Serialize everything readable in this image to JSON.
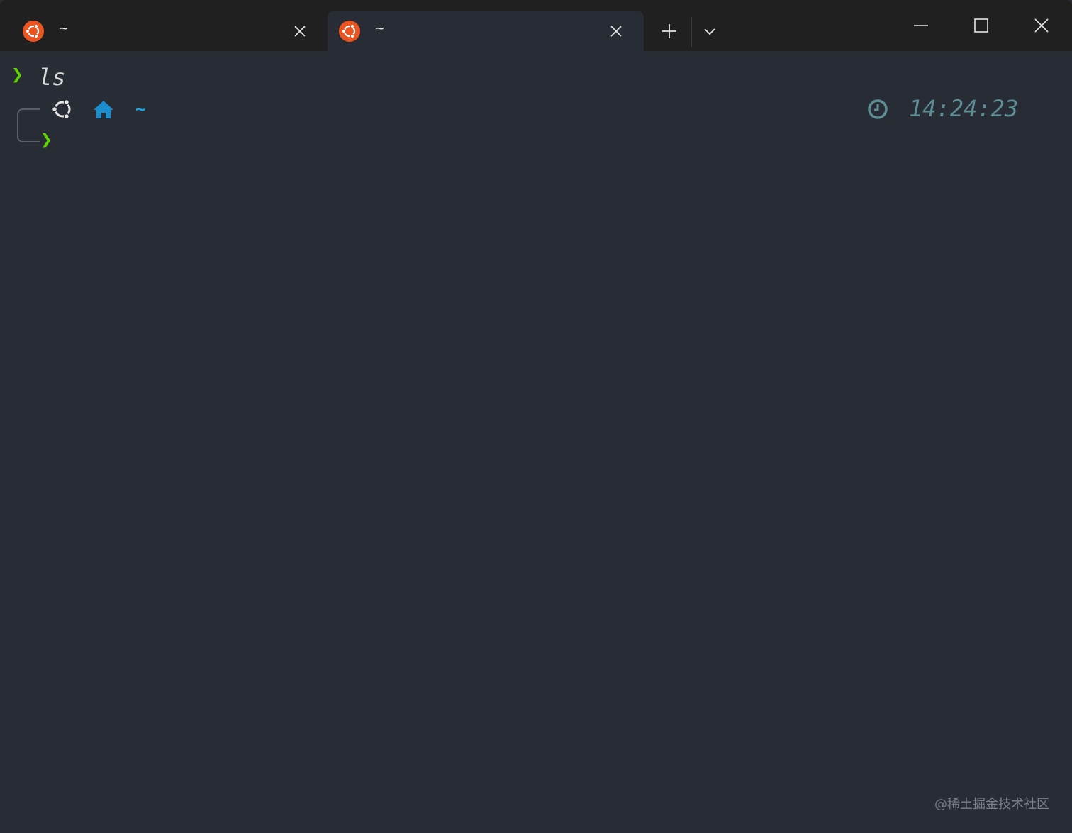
{
  "tabs": [
    {
      "title": "~",
      "icon": "ubuntu-icon",
      "active": false
    },
    {
      "title": "~",
      "icon": "ubuntu-icon",
      "active": true
    }
  ],
  "terminal": {
    "command": "ls",
    "path": "~",
    "time": "14:24:23",
    "prompt_symbol": "❯"
  },
  "watermark": "@稀土掘金技术社区",
  "colors": {
    "ubuntu_orange": "#e95420",
    "prompt_green": "#5fd400",
    "path_blue": "#1aa3e8",
    "time_teal": "#5f8d96",
    "background": "#282c35",
    "titlebar": "#202020"
  }
}
